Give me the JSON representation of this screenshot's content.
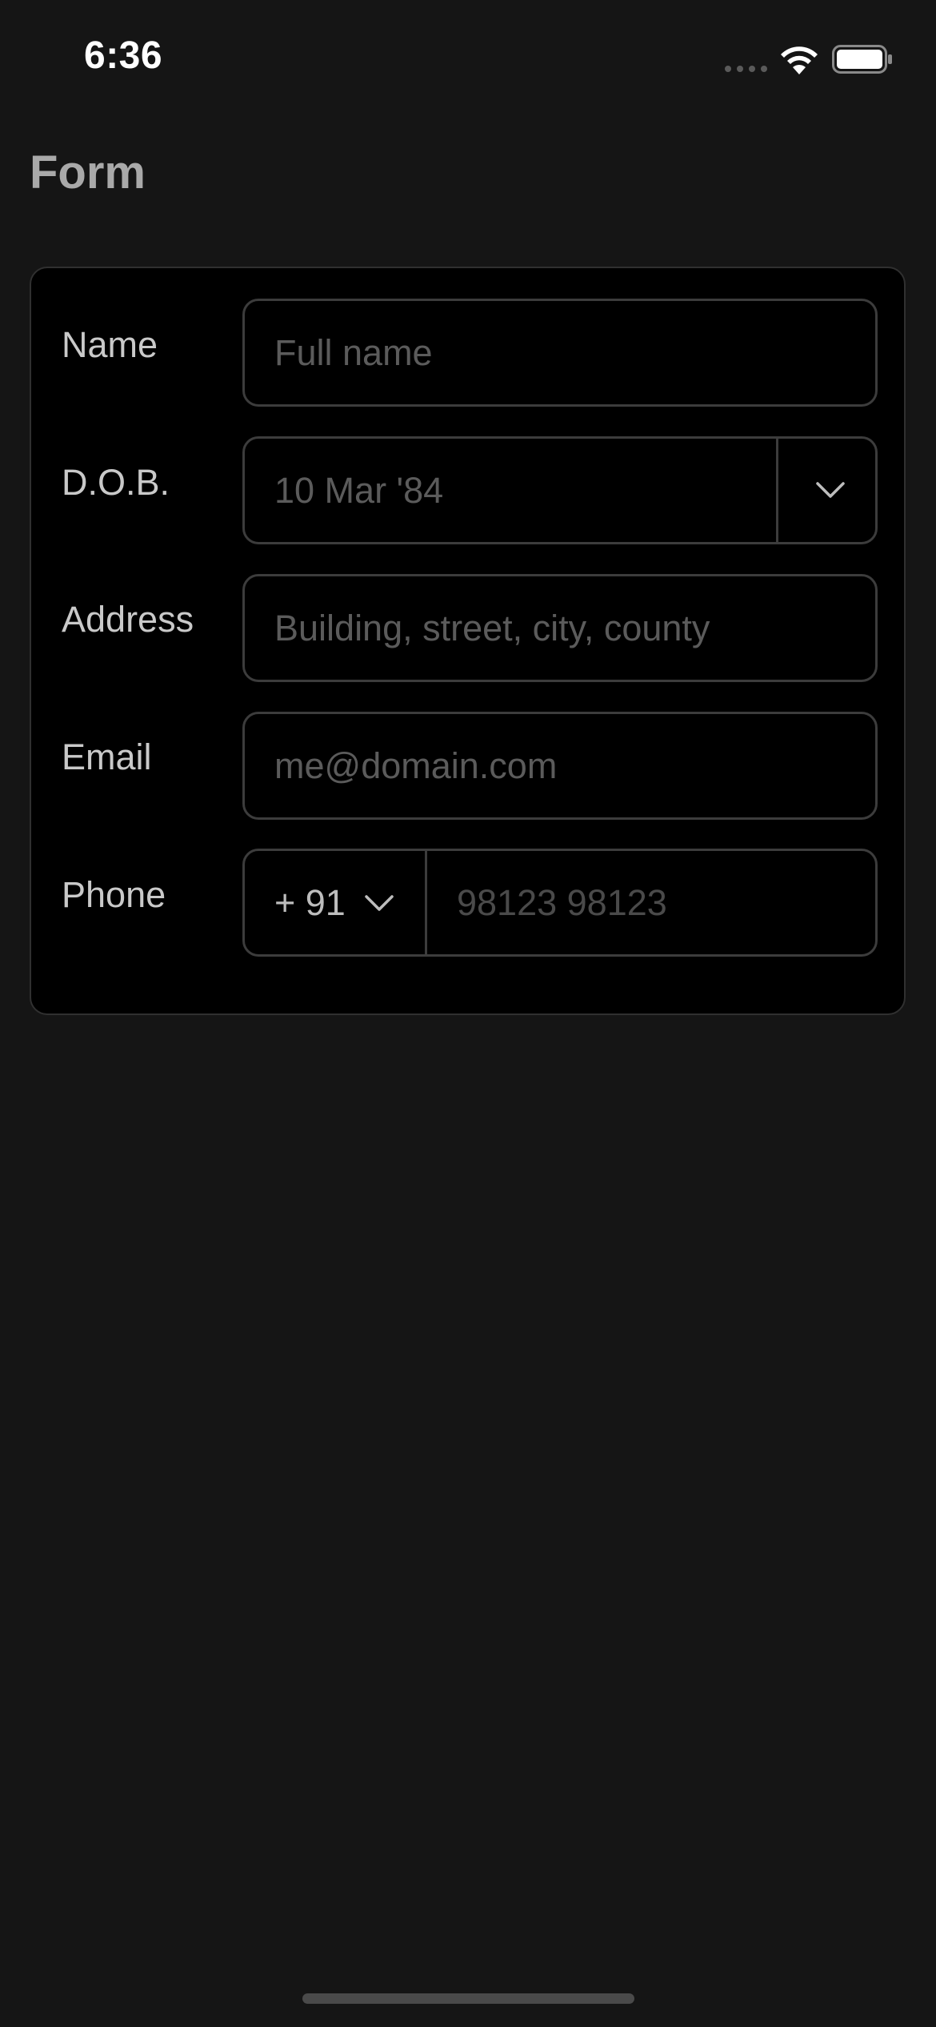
{
  "status_bar": {
    "time": "6:36"
  },
  "header": {
    "title": "Form"
  },
  "form": {
    "name": {
      "label": "Name",
      "placeholder": "Full name"
    },
    "dob": {
      "label": "D.O.B.",
      "placeholder": "10 Mar '84",
      "dropdown_icon": "chevron-down-icon"
    },
    "address": {
      "label": "Address",
      "placeholder": "Building, street, city, county"
    },
    "email": {
      "label": "Email",
      "placeholder": "me@domain.com"
    },
    "phone": {
      "label": "Phone",
      "country_code": "+ 91",
      "country_code_icon": "chevron-down-icon",
      "placeholder": "98123 98123"
    }
  },
  "colors": {
    "background": "#151515",
    "card": "#000000",
    "border": "#3c3c3c",
    "label": "#c9c9c9",
    "placeholder": "#5b5b5b",
    "title": "#a9a9a9"
  }
}
